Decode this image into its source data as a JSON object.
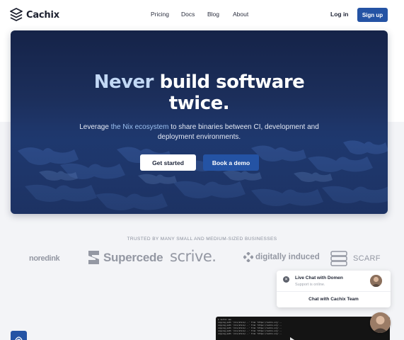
{
  "brand": {
    "name": "Cachix",
    "logo_icon": "stacked-layers-icon",
    "accent": "#2453a4"
  },
  "nav": {
    "links": [
      "Pricing",
      "Docs",
      "Blog",
      "About"
    ],
    "login": "Log in",
    "signup": "Sign up"
  },
  "hero": {
    "title_part1": "Never",
    "title_part2": "build software",
    "title_part3": "twice.",
    "sub_prefix": "Leverage",
    "sub_link": "the Nix ecosystem",
    "sub_suffix": "to share binaries between CI, development and deployment environments.",
    "cta_primary": "Get started",
    "cta_secondary": "Book a demo"
  },
  "trusted": {
    "heading": "TRUSTED BY MANY SMALL AND MEDIUM-SIZED BUSINESSES",
    "companies": [
      "noredink",
      "Supercede",
      "scrive.",
      "digitally induced",
      "SCARF"
    ]
  },
  "chat": {
    "title": "Live Chat with Domen",
    "status": "Support is online.",
    "team_button": "Chat with Cachix Team",
    "close_icon": "close-icon"
  },
  "terminal": {
    "lines": [
      "$ cachix use",
      "copying path '/nix/store/...' from 'https://cachix.org'...",
      "copying path '/nix/store/...' from 'https://cachix.org'...",
      "copying path '/nix/store/...' from 'https://cachix.org'...",
      "copying path '/nix/store/...' from 'https://cachix.org'...",
      "copying path '/nix/store/...' from 'https://cachix.org'..."
    ]
  }
}
